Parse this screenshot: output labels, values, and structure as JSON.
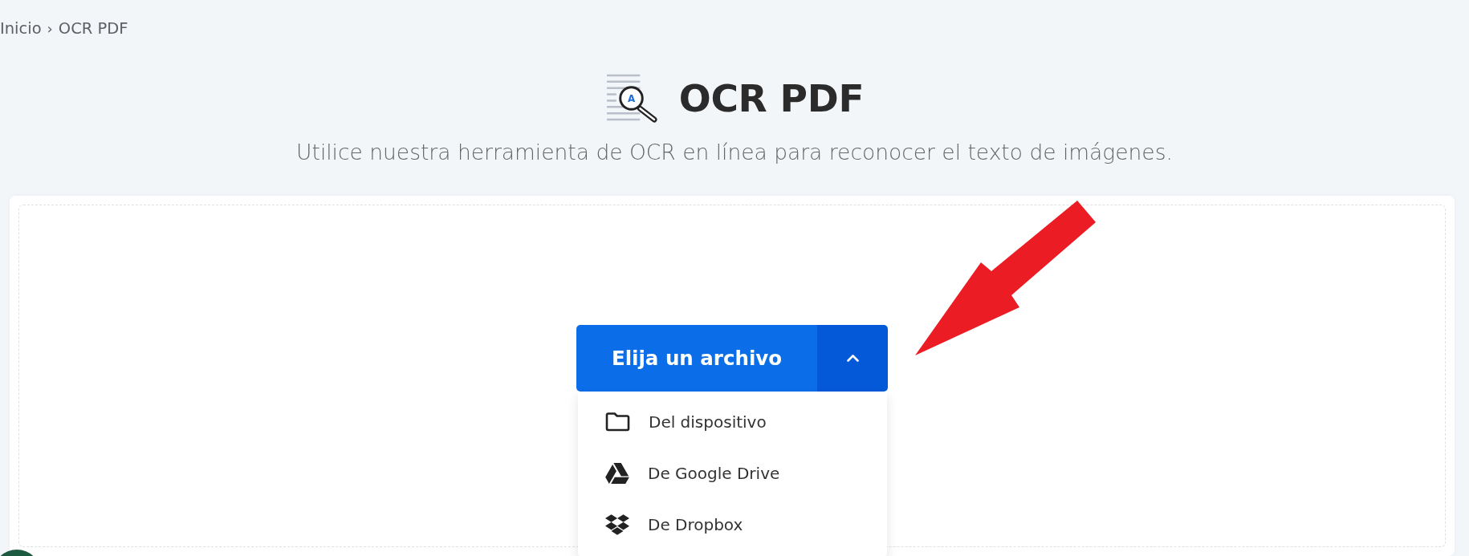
{
  "breadcrumb": {
    "items": [
      {
        "label": "Inicio"
      },
      {
        "label": "OCR PDF"
      }
    ],
    "separator": "›"
  },
  "header": {
    "title": "OCR PDF",
    "icon_letter": "A",
    "subtitle": "Utilice nuestra herramienta de OCR en línea para reconocer el texto de imágenes."
  },
  "upload": {
    "button_label": "Elija un archivo",
    "expanded": true,
    "menu": [
      {
        "kind": "device",
        "label": "Del dispositivo"
      },
      {
        "kind": "google_drive",
        "label": "De Google Drive"
      },
      {
        "kind": "dropbox",
        "label": "De Dropbox"
      }
    ]
  }
}
